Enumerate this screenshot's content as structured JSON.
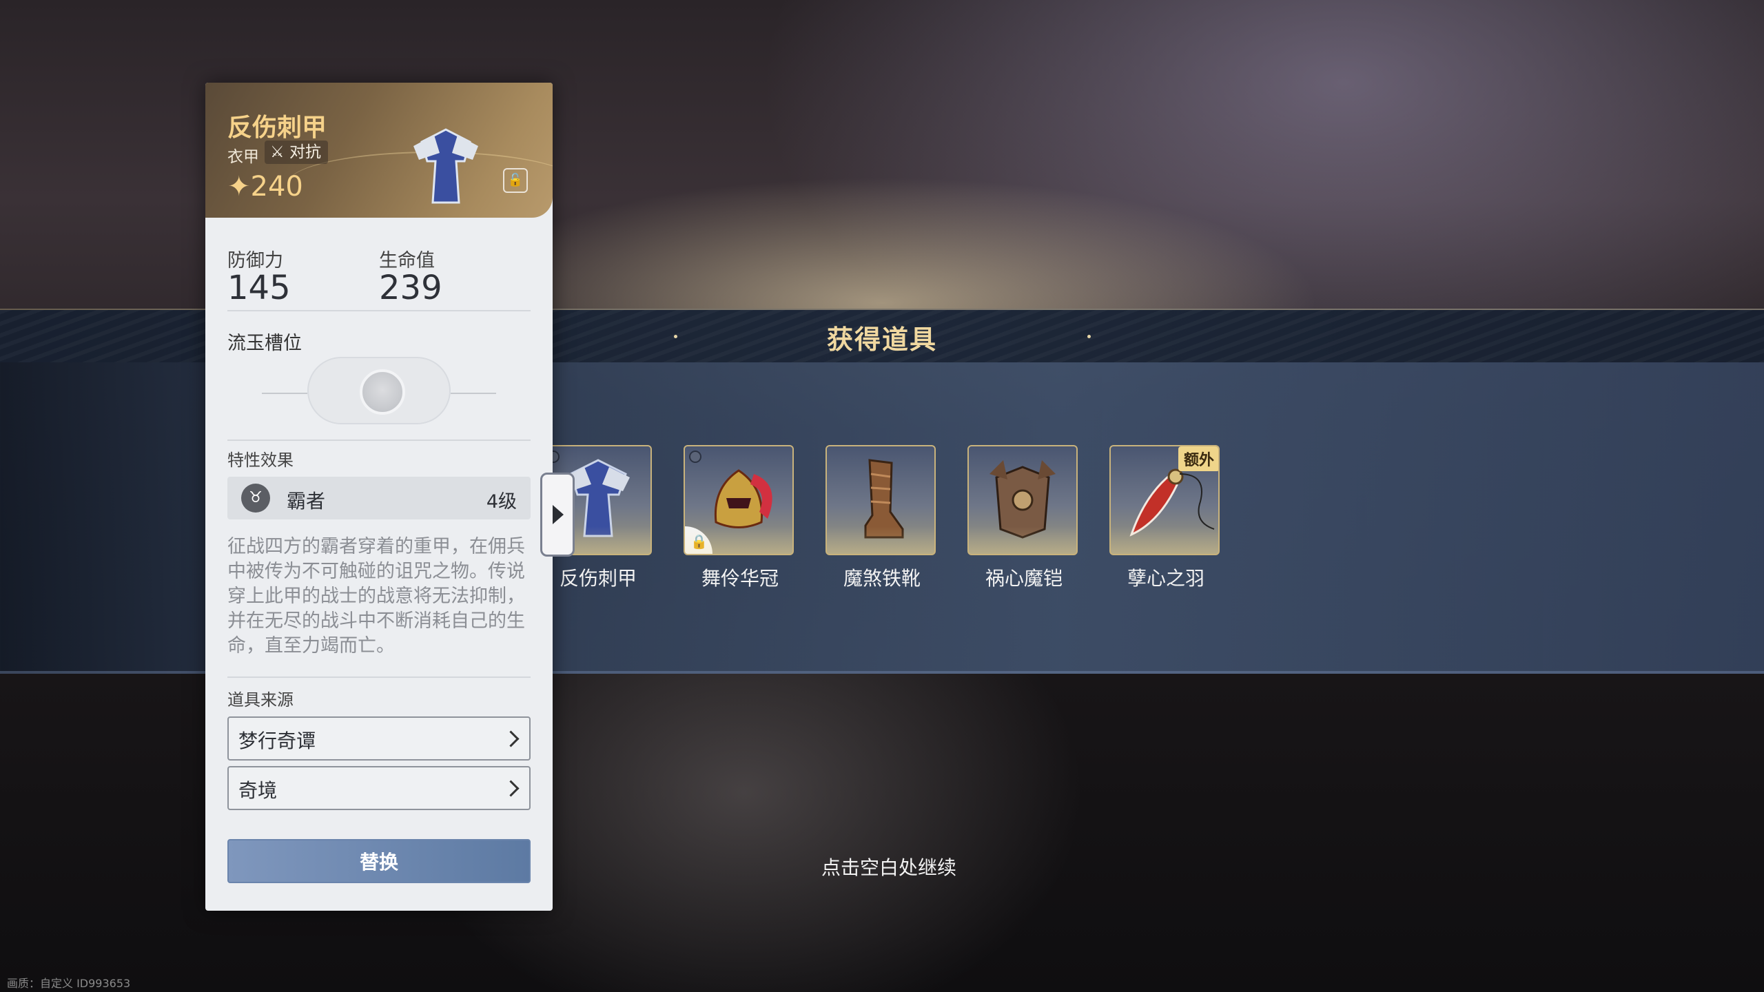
{
  "panel": {
    "item_name": "反伤刺甲",
    "item_type": "衣甲",
    "tag_label": "对抗",
    "score_icon": "sparkle-icon",
    "score": "240",
    "stats": [
      {
        "label": "防御力",
        "value": "145"
      },
      {
        "label": "生命值",
        "value": "239"
      }
    ],
    "slot_section": "流玉槽位",
    "trait_section": "特性效果",
    "trait": {
      "name": "霸者",
      "level": "4级"
    },
    "description": "征战四方的霸者穿着的重甲，在佣兵中被传为不可触碰的诅咒之物。传说穿上此甲的战士的战意将无法抑制，并在无尽的战斗中不断消耗自己的生命，直至力竭而亡。",
    "source_section": "道具来源",
    "sources": [
      "梦行奇谭",
      "奇境"
    ],
    "replace_label": "替换"
  },
  "banner": {
    "title": "获得道具",
    "items": [
      {
        "name": "反伤刺甲",
        "locked": false,
        "extra": false
      },
      {
        "name": "舞伶华冠",
        "locked": true,
        "extra": false
      },
      {
        "name": "魔煞铁靴",
        "locked": false,
        "extra": false
      },
      {
        "name": "祸心魔铠",
        "locked": false,
        "extra": false
      },
      {
        "name": "孽心之羽",
        "locked": false,
        "extra": true
      }
    ],
    "extra_badge": "额外"
  },
  "continue_hint": "点击空白处继续",
  "watermark": "画质：自定义 ID993653",
  "colors": {
    "gold": "#f6d28a",
    "button": "#6d88b0",
    "banner": "#3e4e68"
  }
}
